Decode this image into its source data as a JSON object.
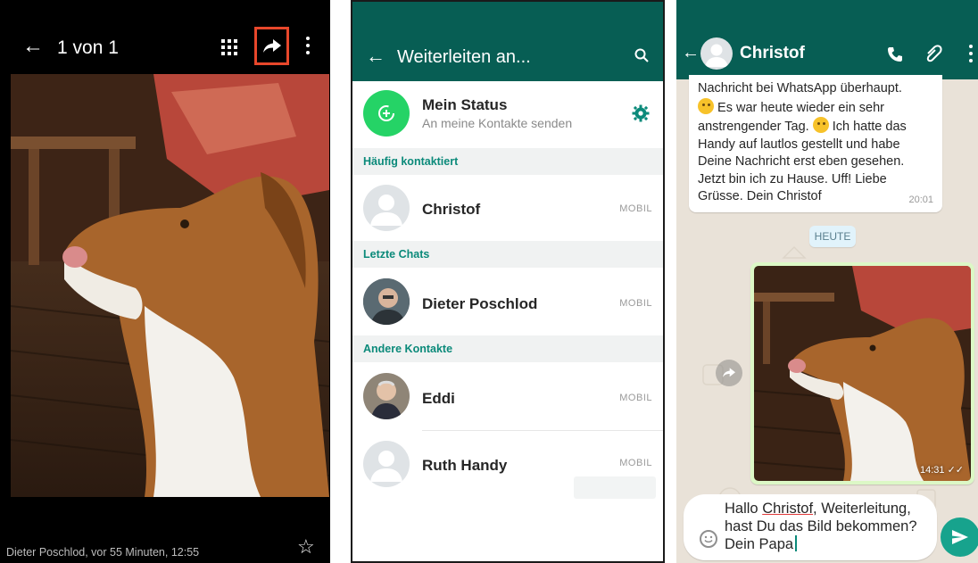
{
  "gallery": {
    "title": "1 von 1",
    "caption": "Dieter Poschlod, vor 55 Minuten, 12:55",
    "icons": [
      "back-arrow-icon",
      "grid-icon",
      "share-icon",
      "more-vert-icon",
      "star-icon"
    ],
    "highlight_color": "#e8472b"
  },
  "forward": {
    "title": "Weiterleiten an...",
    "my_status": {
      "name": "Mein Status",
      "subtitle": "An meine Kontakte senden"
    },
    "sections": {
      "frequent": "Häufig kontaktiert",
      "recent": "Letzte Chats",
      "other": "Andere Kontakte"
    },
    "contacts": {
      "christof": {
        "name": "Christof",
        "tag": "MOBIL"
      },
      "dieter": {
        "name": "Dieter Poschlod",
        "tag": "MOBIL"
      },
      "eddi": {
        "name": "Eddi",
        "tag": "MOBIL"
      },
      "ruth": {
        "name": "Ruth Handy",
        "tag": "MOBIL"
      }
    },
    "colors": {
      "header": "#075e54",
      "accent": "#25d366",
      "section_text": "#0b8a7a"
    }
  },
  "chat": {
    "contact_name": "Christof",
    "incoming": {
      "line1": "Nachricht bei WhatsApp überhaupt.",
      "line2": " Es war heute wieder ein sehr",
      "line3": "anstrengender Tag. ",
      "line3b": " Ich hatte das",
      "line4": "Handy auf lautlos gestellt und habe",
      "line5": "Deine Nachricht erst eben gesehen.",
      "line6": "Jetzt bin ich zu Hause. Uff! Liebe",
      "line7": "Grüsse. Dein Christof",
      "time": "20:01"
    },
    "date_label": "HEUTE",
    "image_time": "14:31",
    "compose": {
      "pre": "Hallo ",
      "name": "Christof",
      "post": ", Weiterleitung, hast Du das Bild bekommen? Dein Papa"
    },
    "colors": {
      "outgoing_bubble": "#dcf8c6",
      "send_button": "#17a38d"
    }
  }
}
